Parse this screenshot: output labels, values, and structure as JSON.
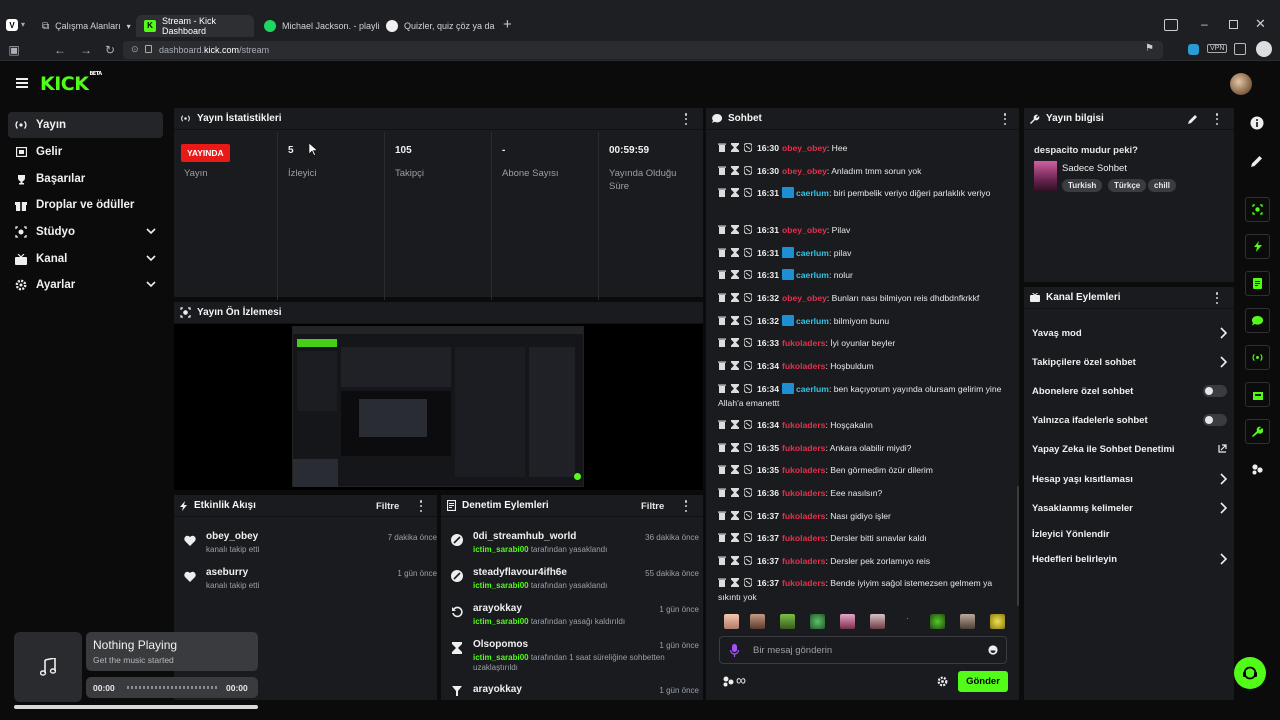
{
  "browser": {
    "tabs": [
      {
        "label": "Çalışma Alanları"
      },
      {
        "label": "Stream - Kick Dashboard"
      },
      {
        "label": "Michael Jackson. - playlist b"
      },
      {
        "label": "Quizler, quiz çöz ya da quiz"
      }
    ],
    "url_prefix": "dashboard.",
    "url_domain": "kick.com",
    "url_path": "/stream",
    "vpn_label": "VPN"
  },
  "brand": {
    "logo": "KICK",
    "beta": "BETA",
    "color": "#53fc18"
  },
  "nav": {
    "items": [
      {
        "label": "Yayın",
        "icon": "broadcast-icon"
      },
      {
        "label": "Gelir",
        "icon": "wallet-icon"
      },
      {
        "label": "Başarılar",
        "icon": "trophy-icon"
      },
      {
        "label": "Droplar ve ödüller",
        "icon": "gift-icon"
      },
      {
        "label": "Stüdyo",
        "icon": "studio-icon"
      },
      {
        "label": "Kanal",
        "icon": "channel-icon"
      },
      {
        "label": "Ayarlar",
        "icon": "gear-icon"
      }
    ]
  },
  "stats": {
    "title": "Yayın İstatistikleri",
    "live_badge": "YAYINDA",
    "cols": [
      {
        "value": "",
        "label": "Yayın"
      },
      {
        "value": "5",
        "label": "İzleyici"
      },
      {
        "value": "105",
        "label": "Takipçi"
      },
      {
        "value": "-",
        "label": "Abone Sayısı"
      },
      {
        "value": "00:59:59",
        "label": "Yayında Olduğu Süre"
      }
    ]
  },
  "preview": {
    "title": "Yayın Ön İzlemesi"
  },
  "activity": {
    "title": "Etkinlik Akışı",
    "filter": "Filtre",
    "items": [
      {
        "name": "obey_obey",
        "sub": "kanalı takip etti",
        "time": "7 dakika önce"
      },
      {
        "name": "aseburry",
        "sub": "kanalı takip etti",
        "time": "1 gün önce"
      }
    ]
  },
  "moderation": {
    "title": "Denetim Eylemleri",
    "filter": "Filtre",
    "items": [
      {
        "name": "0di_streamhub_world",
        "mod": "ictim_sarabi00",
        "action": " tarafından yasaklandı",
        "time": "36 dakika önce"
      },
      {
        "name": "steadyflavour4ifh6e",
        "mod": "ictim_sarabi00",
        "action": " tarafından yasaklandı",
        "time": "55 dakika önce"
      },
      {
        "name": "arayokkay",
        "mod": "ictim_sarabi00",
        "action": " tarafından yasağı kaldırıldı",
        "time": "1 gün önce"
      },
      {
        "name": "Olsopomos",
        "mod": "ictim_sarabi00",
        "action": " tarafından 1 saat süreliğine sohbetten uzaklaştırıldı",
        "time": "1 gün önce"
      },
      {
        "name": "arayokkay",
        "mod": "",
        "action": "",
        "time": "1 gün önce"
      }
    ]
  },
  "chat": {
    "title": "Sohbet",
    "input_placeholder": "Bir mesaj gönderin",
    "send": "Gönder",
    "messages": [
      {
        "time": "16:30",
        "user": "obey_obey",
        "text": ": Hee"
      },
      {
        "time": "16:30",
        "user": "obey_obey",
        "text": ": Anladım tmm sorun yok"
      },
      {
        "time": "16:31",
        "user": "caerlum",
        "text": ": biri pembelik veriyo diğeri parlaklık veriyo"
      },
      {
        "time": "16:31",
        "user": "obey_obey",
        "text": ": Pilav"
      },
      {
        "time": "16:31",
        "user": "caerlum",
        "text": ": pilav"
      },
      {
        "time": "16:31",
        "user": "caerlum",
        "text": ": nolur"
      },
      {
        "time": "16:32",
        "user": "obey_obey",
        "text": ": Bunları nası bilmiyon reis dhdbdnfkrkkf"
      },
      {
        "time": "16:32",
        "user": "caerlum",
        "text": ": bilmiyom bunu"
      },
      {
        "time": "16:33",
        "user": "fukoladers",
        "text": ": İyi oyunlar beyler"
      },
      {
        "time": "16:34",
        "user": "fukoladers",
        "text": ": Hoşbuldum"
      },
      {
        "time": "16:34",
        "user": "caerlum",
        "text": ": ben kaçıyorum yayında olursam gelirim yine Allah'a emanettt"
      },
      {
        "time": "16:34",
        "user": "fukoladers",
        "text": ": Hoşçakalın"
      },
      {
        "time": "16:35",
        "user": "fukoladers",
        "text": ": Ankara olabilir miydi?"
      },
      {
        "time": "16:35",
        "user": "fukoladers",
        "text": ": Ben görmedim özür dilerim"
      },
      {
        "time": "16:36",
        "user": "fukoladers",
        "text": ": Eee nasılsın?"
      },
      {
        "time": "16:37",
        "user": "fukoladers",
        "text": ": Nası gidiyo işler"
      },
      {
        "time": "16:37",
        "user": "fukoladers",
        "text": ": Dersler bitti sınavlar kaldı"
      },
      {
        "time": "16:37",
        "user": "fukoladers",
        "text": ": Dersler pek zorlamıyo reis"
      },
      {
        "time": "16:37",
        "user": "fukoladers",
        "text": ": Bende iyiyim sağol istemezsen gelmem ya sıkıntı yok"
      }
    ]
  },
  "stream_info": {
    "title": "Yayın bilgisi",
    "stream_title": "despacito mudur peki?",
    "category": "Sadece Sohbet",
    "tags": [
      "Turkish",
      "Türkçe",
      "chill"
    ]
  },
  "channel_actions": {
    "title": "Kanal Eylemleri",
    "items": [
      {
        "label": "Yavaş mod",
        "control": "chevron"
      },
      {
        "label": "Takipçilere özel sohbet",
        "control": "chevron"
      },
      {
        "label": "Abonelere özel sohbet",
        "control": "toggle"
      },
      {
        "label": "Yalnızca ifadelerle sohbet",
        "control": "toggle"
      },
      {
        "label": "Yapay Zeka ile Sohbet Denetimi",
        "control": "external"
      },
      {
        "label": "Hesap yaşı kısıtlaması",
        "control": "chevron"
      },
      {
        "label": "Yasaklanmış kelimeler",
        "control": "chevron"
      },
      {
        "label": "İzleyici Yönlendir",
        "control": "none"
      },
      {
        "label": "Hedefleri belirleyin",
        "control": "chevron"
      }
    ]
  },
  "player": {
    "title": "Nothing Playing",
    "subtitle": "Get the music started",
    "time_start": "00:00",
    "time_end": "00:00"
  }
}
